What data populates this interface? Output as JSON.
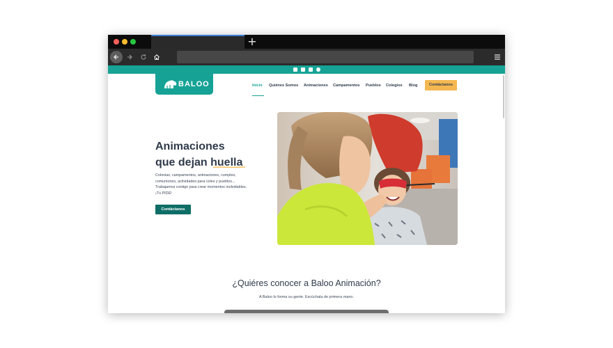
{
  "browser": {
    "dots": [
      "#ff5f57",
      "#ffbd2e",
      "#28c840"
    ],
    "new_tab_label": "+",
    "back_icon": "arrow-left-icon",
    "forward_icon": "arrow-right-icon",
    "reload_icon": "reload-icon",
    "home_icon": "home-icon",
    "menu_icon": "hamburger-icon"
  },
  "site": {
    "accent": "#16a396",
    "dark_accent": "#0e6e66",
    "cta_color": "#f5b851",
    "top_icons": [
      "instagram-icon",
      "facebook-icon",
      "email-icon",
      "whatsapp-icon"
    ],
    "logo_text": "BALOO",
    "nav": [
      {
        "label": "Inicio",
        "active": true
      },
      {
        "label": "Quiénes Somos"
      },
      {
        "label": "Animaciones"
      },
      {
        "label": "Campamentos"
      },
      {
        "label": "Pueblos"
      },
      {
        "label": "Colegios"
      },
      {
        "label": "Blog"
      }
    ],
    "nav_cta": "Contáctanos",
    "hero": {
      "title_line1": "Animaciones",
      "title_line2_a": "que dejan ",
      "title_line2_b": "huella",
      "text": "Colonias, campamentos, animaciones, cumples, comuniones, actividades para coles y pueblos... Trabajamos contigo para crear momentos inolvidables. ¡Tú PIDE!",
      "cta": "Contáctanos"
    },
    "section": {
      "title": "¿Quiéres conocer a Baloo Animación?",
      "subtitle": "A Baloo lo forma su gente. Escúchala de primera mano."
    }
  }
}
